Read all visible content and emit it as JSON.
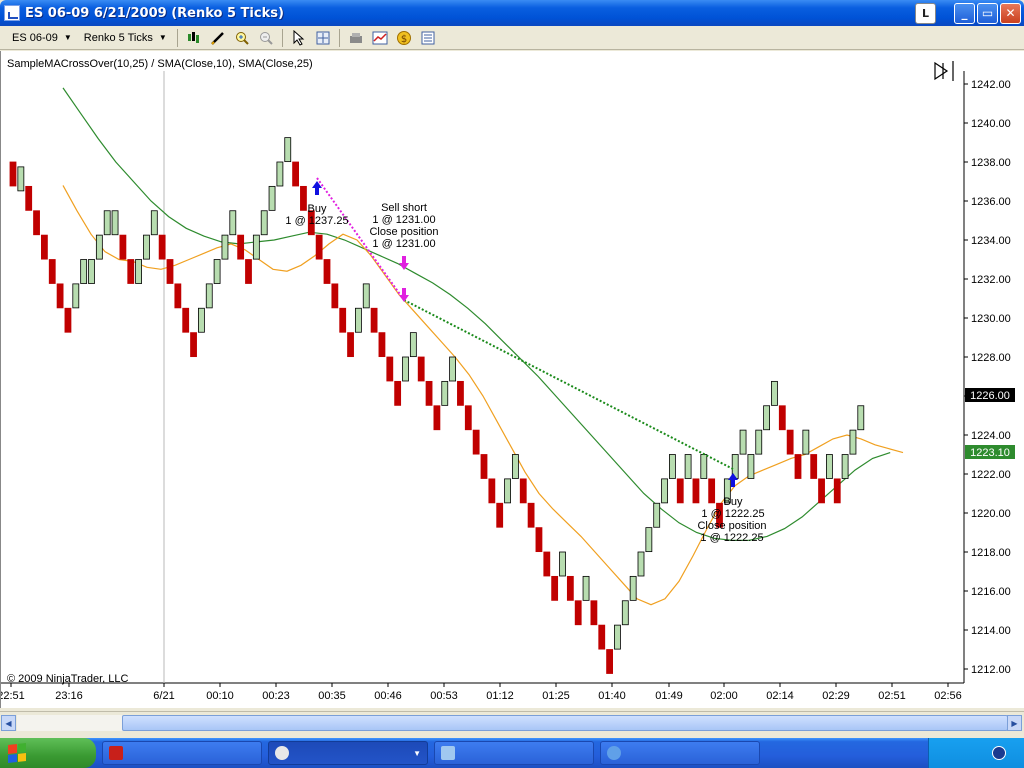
{
  "window": {
    "title": "ES 06-09  6/21/2009 (Renko 5 Ticks)",
    "btn_l": "L",
    "btn_min": "_",
    "btn_max": "▭",
    "btn_close": "✕"
  },
  "toolbar": {
    "instrument": "ES 06-09",
    "period": "Renko 5 Ticks",
    "icons": [
      "candlestick-icon",
      "pencil-icon",
      "zoom-in-icon",
      "zoom-out-icon",
      "pointer-icon",
      "crosshair-icon",
      "properties-icon",
      "chart-style-icon",
      "currency-icon",
      "data-box-icon"
    ]
  },
  "chart": {
    "indicator_label": "SampleMACrossOver(10,25) / SMA(Close,10), SMA(Close,25)",
    "copyright": "© 2009 NinjaTrader, LLC",
    "last_price": "1226.00",
    "sma_price": "1223.10",
    "annotations": [
      {
        "lines": [
          "Buy",
          "1 @ 1237.25"
        ]
      },
      {
        "lines": [
          "Sell short",
          "1 @ 1231.00",
          "Close position",
          "1 @ 1231.00"
        ]
      },
      {
        "lines": [
          "Buy",
          "1 @ 1222.25",
          "Close position",
          "1 @ 1222.25"
        ]
      }
    ],
    "colors": {
      "up": "#b8ddb0",
      "down": "#c00000",
      "sma10": "#f0a020",
      "sma25": "#2e8b2e",
      "buy": "#1010e0",
      "sell": "#e020e0"
    }
  },
  "chart_data": {
    "type": "candlestick-renko",
    "title": "SampleMACrossOver(10,25) / SMA(Close,10), SMA(Close,25)",
    "ylim": [
      1211,
      1243
    ],
    "y_ticks": [
      1212,
      1214,
      1216,
      1218,
      1220,
      1222,
      1224,
      1226,
      1228,
      1230,
      1232,
      1234,
      1236,
      1238,
      1240,
      1242
    ],
    "x_ticks": [
      "22:51",
      "23:16",
      "6/21",
      "00:10",
      "00:23",
      "00:35",
      "00:46",
      "00:53",
      "01:12",
      "01:25",
      "01:40",
      "01:49",
      "02:00",
      "02:14",
      "02:29",
      "02:51",
      "02:56"
    ],
    "bricks": [
      [
        1238.0,
        "d"
      ],
      [
        1237.75,
        "u"
      ],
      [
        1236.75,
        "d"
      ],
      [
        1235.5,
        "d"
      ],
      [
        1234.25,
        "d"
      ],
      [
        1233.0,
        "d"
      ],
      [
        1231.75,
        "d"
      ],
      [
        1230.5,
        "d"
      ],
      [
        1231.75,
        "u"
      ],
      [
        1233.0,
        "u"
      ],
      [
        1233.0,
        "u"
      ],
      [
        1234.25,
        "u"
      ],
      [
        1235.5,
        "u"
      ],
      [
        1235.5,
        "u"
      ],
      [
        1234.25,
        "d"
      ],
      [
        1233.0,
        "d"
      ],
      [
        1233.0,
        "u"
      ],
      [
        1234.25,
        "u"
      ],
      [
        1235.5,
        "u"
      ],
      [
        1234.25,
        "d"
      ],
      [
        1233.0,
        "d"
      ],
      [
        1231.75,
        "d"
      ],
      [
        1230.5,
        "d"
      ],
      [
        1229.25,
        "d"
      ],
      [
        1230.5,
        "u"
      ],
      [
        1231.75,
        "u"
      ],
      [
        1233.0,
        "u"
      ],
      [
        1234.25,
        "u"
      ],
      [
        1235.5,
        "u"
      ],
      [
        1234.25,
        "d"
      ],
      [
        1233.0,
        "d"
      ],
      [
        1234.25,
        "u"
      ],
      [
        1235.5,
        "u"
      ],
      [
        1236.75,
        "u"
      ],
      [
        1238.0,
        "u"
      ],
      [
        1239.25,
        "u"
      ],
      [
        1238.0,
        "d"
      ],
      [
        1236.75,
        "d"
      ],
      [
        1235.5,
        "d"
      ],
      [
        1234.25,
        "d"
      ],
      [
        1233.0,
        "d"
      ],
      [
        1231.75,
        "d"
      ],
      [
        1230.5,
        "d"
      ],
      [
        1229.25,
        "d"
      ],
      [
        1230.5,
        "u"
      ],
      [
        1231.75,
        "u"
      ],
      [
        1230.5,
        "d"
      ],
      [
        1229.25,
        "d"
      ],
      [
        1228.0,
        "d"
      ],
      [
        1226.75,
        "d"
      ],
      [
        1228.0,
        "u"
      ],
      [
        1229.25,
        "u"
      ],
      [
        1228.0,
        "d"
      ],
      [
        1226.75,
        "d"
      ],
      [
        1225.5,
        "d"
      ],
      [
        1226.75,
        "u"
      ],
      [
        1228.0,
        "u"
      ],
      [
        1226.75,
        "d"
      ],
      [
        1225.5,
        "d"
      ],
      [
        1224.25,
        "d"
      ],
      [
        1223.0,
        "d"
      ],
      [
        1221.75,
        "d"
      ],
      [
        1220.5,
        "d"
      ],
      [
        1221.75,
        "u"
      ],
      [
        1223.0,
        "u"
      ],
      [
        1221.75,
        "d"
      ],
      [
        1220.5,
        "d"
      ],
      [
        1219.25,
        "d"
      ],
      [
        1218.0,
        "d"
      ],
      [
        1216.75,
        "d"
      ],
      [
        1218.0,
        "u"
      ],
      [
        1216.75,
        "d"
      ],
      [
        1215.5,
        "d"
      ],
      [
        1216.75,
        "u"
      ],
      [
        1215.5,
        "d"
      ],
      [
        1214.25,
        "d"
      ],
      [
        1213.0,
        "d"
      ],
      [
        1214.25,
        "u"
      ],
      [
        1215.5,
        "u"
      ],
      [
        1216.75,
        "u"
      ],
      [
        1218.0,
        "u"
      ],
      [
        1219.25,
        "u"
      ],
      [
        1220.5,
        "u"
      ],
      [
        1221.75,
        "u"
      ],
      [
        1223.0,
        "u"
      ],
      [
        1221.75,
        "d"
      ],
      [
        1223.0,
        "u"
      ],
      [
        1221.75,
        "d"
      ],
      [
        1223.0,
        "u"
      ],
      [
        1221.75,
        "d"
      ],
      [
        1220.5,
        "d"
      ],
      [
        1221.75,
        "u"
      ],
      [
        1223.0,
        "u"
      ],
      [
        1224.25,
        "u"
      ],
      [
        1223.0,
        "u"
      ],
      [
        1224.25,
        "u"
      ],
      [
        1225.5,
        "u"
      ],
      [
        1226.75,
        "u"
      ],
      [
        1225.5,
        "d"
      ],
      [
        1224.25,
        "d"
      ],
      [
        1223.0,
        "d"
      ],
      [
        1224.25,
        "u"
      ],
      [
        1223.0,
        "d"
      ],
      [
        1221.75,
        "d"
      ],
      [
        1223.0,
        "u"
      ],
      [
        1221.75,
        "d"
      ],
      [
        1223.0,
        "u"
      ],
      [
        1224.25,
        "u"
      ],
      [
        1225.5,
        "u"
      ]
    ],
    "series": [
      {
        "values_sma10": [
          1236.8,
          1235.5,
          1234.3,
          1233.4,
          1233.0,
          1232.9,
          1232.6,
          1232.5,
          1232.7,
          1233.0,
          1233.3,
          1233.6,
          1233.8,
          1233.5,
          1233.0,
          1232.5,
          1232.4,
          1232.7,
          1233.2,
          1233.8,
          1234.3,
          1234.0,
          1233.2,
          1232.2,
          1231.2,
          1230.4,
          1229.6,
          1228.8,
          1228.0,
          1227.1,
          1226.0,
          1224.7,
          1223.4,
          1222.1,
          1221.0,
          1220.2,
          1219.5,
          1218.8,
          1218.0,
          1217.2,
          1216.4,
          1215.6,
          1215.3,
          1215.6,
          1216.5,
          1217.8,
          1219.2,
          1220.5,
          1221.4,
          1221.9,
          1222.2,
          1222.5,
          1222.8,
          1223.0,
          1223.4,
          1223.8,
          1224.0,
          1223.8,
          1223.5,
          1223.3,
          1223.1
        ]
      },
      {
        "values_sma25": [
          1241.8,
          1240.5,
          1239.2,
          1238.0,
          1237.0,
          1236.0,
          1235.2,
          1234.6,
          1234.2,
          1233.9,
          1233.8,
          1233.9,
          1234.0,
          1234.2,
          1234.4,
          1234.3,
          1234.0,
          1233.6,
          1233.2,
          1232.8,
          1232.3,
          1231.8,
          1231.2,
          1230.5,
          1229.7,
          1228.8,
          1227.9,
          1227.0,
          1226.0,
          1225.0,
          1224.0,
          1223.0,
          1222.0,
          1221.0,
          1220.2,
          1219.5,
          1219.0,
          1218.7,
          1218.6,
          1218.6,
          1218.8,
          1219.2,
          1219.8,
          1220.6,
          1221.4,
          1222.2,
          1222.8,
          1223.1
        ]
      }
    ]
  }
}
